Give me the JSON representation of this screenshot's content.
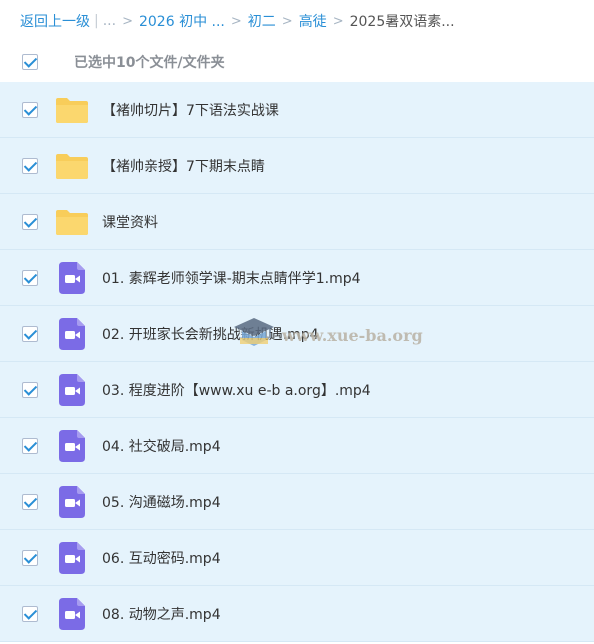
{
  "breadcrumb": {
    "back": "返回上一级",
    "ellipsis": "...",
    "items": [
      "2026 初中 ...",
      "初二",
      "高徒"
    ],
    "current": "2025暑双语素..."
  },
  "selection": {
    "label": "已选中10个文件/文件夹",
    "checked": true
  },
  "files": [
    {
      "type": "folder",
      "name": "【褚帅切片】7下语法实战课"
    },
    {
      "type": "folder",
      "name": "【褚帅亲授】7下期末点睛"
    },
    {
      "type": "folder",
      "name": "课堂资料"
    },
    {
      "type": "video",
      "name": "01. 素辉老师领学课-期末点睛伴学1.mp4"
    },
    {
      "type": "video",
      "name": "02. 开班家长会新挑战新机遇.mp4"
    },
    {
      "type": "video",
      "name": "03. 程度进阶【www.xu e-b a.org】.mp4"
    },
    {
      "type": "video",
      "name": "04. 社交破局.mp4"
    },
    {
      "type": "video",
      "name": "05. 沟通磁场.mp4"
    },
    {
      "type": "video",
      "name": "06. 互动密码.mp4"
    },
    {
      "type": "video",
      "name": "08. 动物之声.mp4"
    }
  ],
  "watermark": {
    "text": "www.xue-ba.org"
  },
  "colors": {
    "link": "#2a8fd6",
    "row_bg": "#e5f3fc",
    "folder": "#f8cd5a",
    "video": "#7b6be6"
  }
}
